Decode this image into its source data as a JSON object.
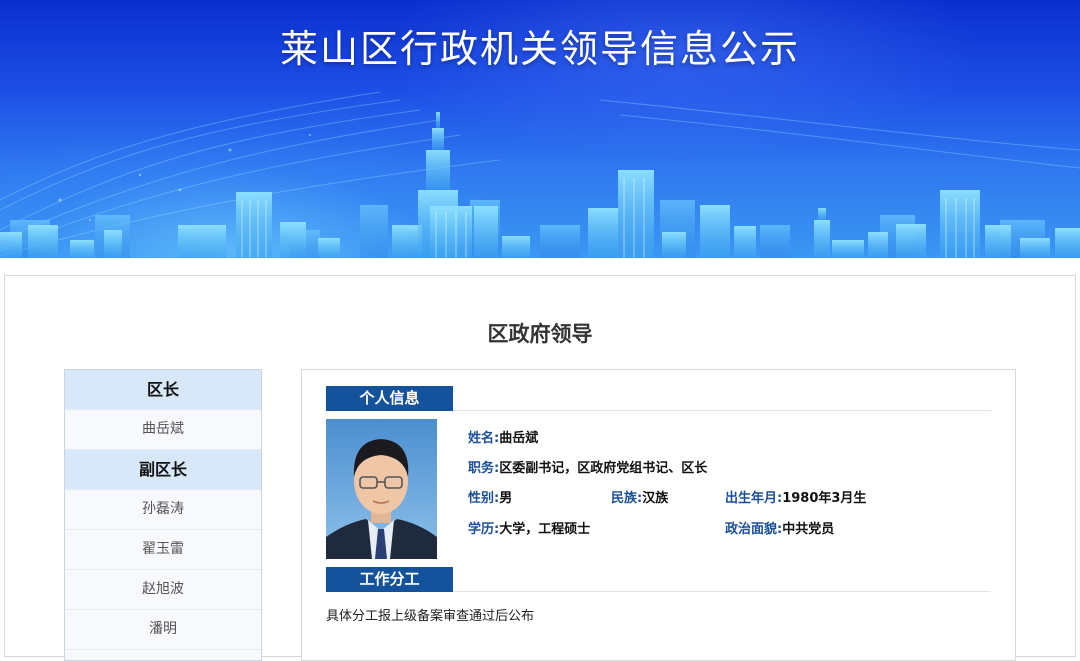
{
  "banner": {
    "title": "莱山区行政机关领导信息公示"
  },
  "page": {
    "section_title": "区政府领导"
  },
  "sidebar": {
    "groups": [
      {
        "label": "区长",
        "items": [
          "曲岳斌"
        ]
      },
      {
        "label": "副区长",
        "items": [
          "孙磊涛",
          "翟玉雷",
          "赵旭波",
          "潘明"
        ]
      }
    ]
  },
  "profile": {
    "tab_info": "个人信息",
    "tab_duty": "工作分工",
    "name_label": "姓名:",
    "name": "曲岳斌",
    "position_label": "职务:",
    "position": "区委副书记，区政府党组书记、区长",
    "gender_label": "性别:",
    "gender": "男",
    "ethnicity_label": "民族:",
    "ethnicity": "汉族",
    "birth_label": "出生年月:",
    "birth": "1980年3月生",
    "education_label": "学历:",
    "education": "大学，工程硕士",
    "politics_label": "政治面貌:",
    "politics": "中共党员",
    "duty_text": "具体分工报上级备案审查通过后公布"
  },
  "colors": {
    "banner_top": "#0b2fcf",
    "tag_bg": "#15529c",
    "label_blue": "#1b4f9a",
    "menu_group_bg": "#d9e8f8"
  }
}
